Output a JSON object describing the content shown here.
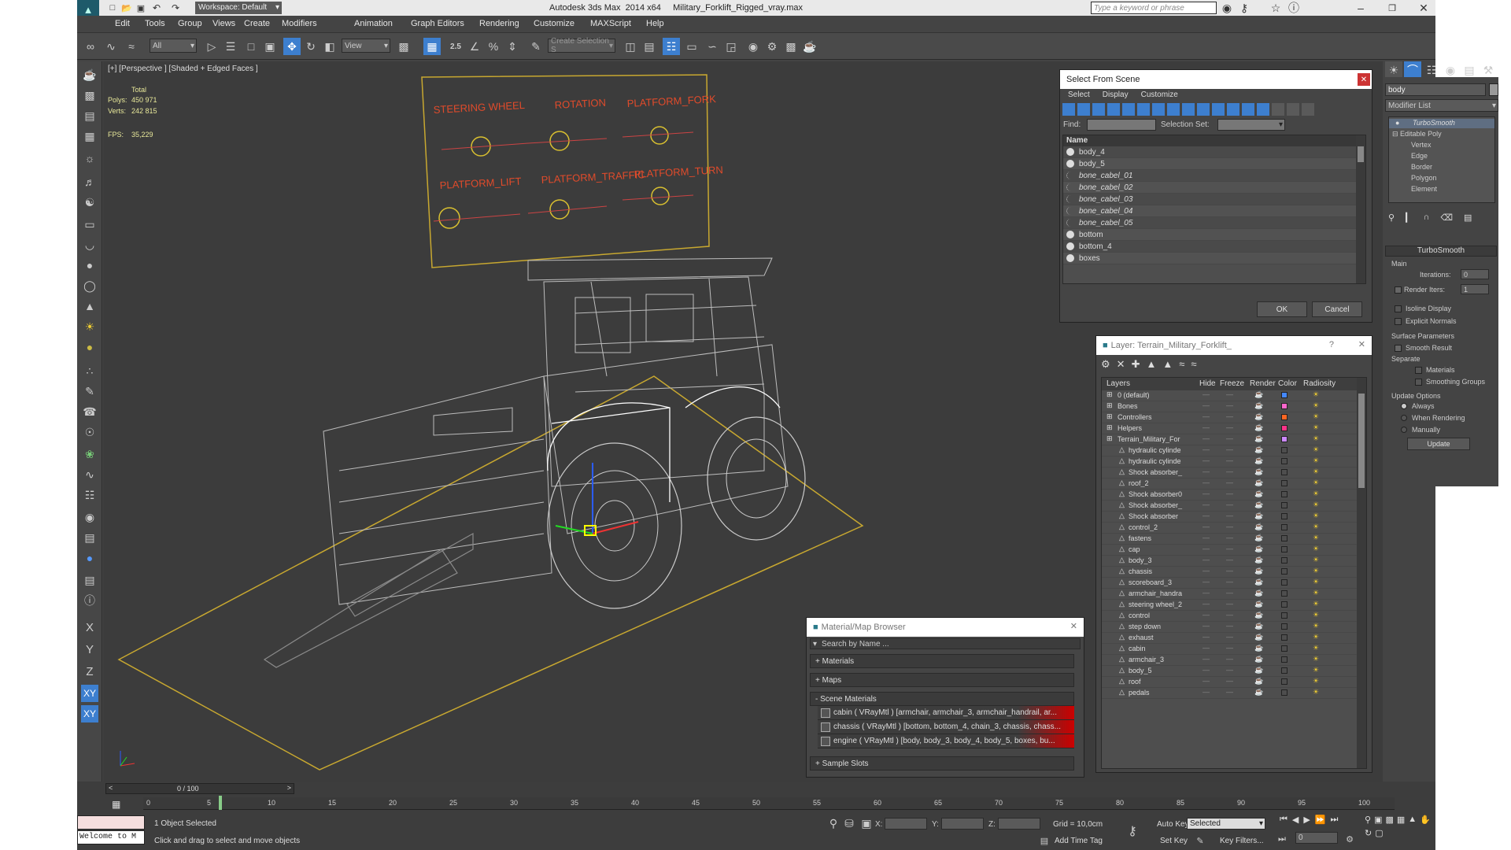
{
  "window": {
    "title": "Autodesk 3ds Max  2014 x64     Military_Forklift_Rigged_vray.max",
    "workspace": "Workspace: Default",
    "search_placeholder": "Type a keyword or phrase"
  },
  "menu": [
    "Edit",
    "Tools",
    "Group",
    "Views",
    "Create",
    "Modifiers",
    "Animation",
    "Graph Editors",
    "Rendering",
    "Customize",
    "MAXScript",
    "Help"
  ],
  "toolbar": {
    "filter": "All",
    "ref_coord": "View",
    "snap_label": "2.5",
    "selection_set": "Create Selection S"
  },
  "viewport": {
    "label": "[+] [Perspective ] [Shaded + Edged Faces ]",
    "stats": {
      "total": "Total",
      "polys_label": "Polys:",
      "polys": "450 971",
      "verts_label": "Verts:",
      "verts": "242 815",
      "fps_label": "FPS:",
      "fps": "35,229"
    },
    "board_labels": [
      "STEERING WHEEL",
      "ROTATION",
      "PLATFORM_FORK",
      "PLATFORM_LIFT",
      "PLATFORM_TRAFFIC",
      "PLATFORM_TURN"
    ]
  },
  "select_from_scene": {
    "title": "Select From Scene",
    "menu": [
      "Select",
      "Display",
      "Customize"
    ],
    "find_label": "Find:",
    "selection_set_label": "Selection Set:",
    "column": "Name",
    "items": [
      "body_4",
      "body_5",
      "bone_cabel_01",
      "bone_cabel_02",
      "bone_cabel_03",
      "bone_cabel_04",
      "bone_cabel_05",
      "bottom",
      "bottom_4",
      "boxes"
    ],
    "ok": "OK",
    "cancel": "Cancel"
  },
  "layer_dialog": {
    "title": "Layer: Terrain_Military_Forklift_",
    "help": "?",
    "columns": [
      "Layers",
      "Hide",
      "Freeze",
      "Render",
      "Color",
      "Radiosity"
    ],
    "layers": [
      {
        "name": "0 (default)",
        "indent": 0,
        "color": "#4488ff"
      },
      {
        "name": "Bones",
        "indent": 0,
        "color": "#ff66cc"
      },
      {
        "name": "Controllers",
        "indent": 0,
        "color": "#ff6622"
      },
      {
        "name": "Helpers",
        "indent": 0,
        "color": "#ff3388"
      },
      {
        "name": "Terrain_Military_For",
        "indent": 0,
        "color": "#cc88ff"
      },
      {
        "name": "hydraulic cylinde",
        "indent": 1
      },
      {
        "name": "hydraulic cylinde",
        "indent": 1
      },
      {
        "name": "Shock absorber_",
        "indent": 1
      },
      {
        "name": "roof_2",
        "indent": 1
      },
      {
        "name": "Shock absorber0",
        "indent": 1
      },
      {
        "name": "Shock absorber_",
        "indent": 1
      },
      {
        "name": "Shock absorber",
        "indent": 1
      },
      {
        "name": "control_2",
        "indent": 1
      },
      {
        "name": "fastens",
        "indent": 1
      },
      {
        "name": "cap",
        "indent": 1
      },
      {
        "name": "body_3",
        "indent": 1
      },
      {
        "name": "chassis",
        "indent": 1
      },
      {
        "name": "scoreboard_3",
        "indent": 1
      },
      {
        "name": "armchair_handra",
        "indent": 1
      },
      {
        "name": "steering wheel_2",
        "indent": 1
      },
      {
        "name": "control",
        "indent": 1
      },
      {
        "name": "step down",
        "indent": 1
      },
      {
        "name": "exhaust",
        "indent": 1
      },
      {
        "name": "cabin",
        "indent": 1
      },
      {
        "name": "armchair_3",
        "indent": 1
      },
      {
        "name": "body_5",
        "indent": 1
      },
      {
        "name": "roof",
        "indent": 1
      },
      {
        "name": "pedals",
        "indent": 1
      }
    ]
  },
  "material_browser": {
    "title": "Material/Map Browser",
    "search": "Search by Name ...",
    "sections": [
      "+ Materials",
      "+ Maps",
      "- Scene Materials"
    ],
    "materials": [
      "cabin  ( VRayMtl )  [armchair, armchair_3, armchair_handrail, ar...",
      "chassis  ( VRayMtl )  [bottom, bottom_4, chain_3, chassis, chass...",
      "engine  ( VRayMtl )  [body, body_3, body_4, body_5, boxes, bu..."
    ],
    "sample_slots": "+ Sample Slots"
  },
  "command_panel": {
    "object_name": "body",
    "modifier_list": "Modifier List",
    "stack": [
      "TurboSmooth",
      "Editable Poly",
      "Vertex",
      "Edge",
      "Border",
      "Polygon",
      "Element"
    ],
    "rollout": "TurboSmooth",
    "main": "Main",
    "iterations_label": "Iterations:",
    "iterations": "0",
    "render_iters_label": "Render Iters:",
    "render_iters": "1",
    "isoline": "Isoline Display",
    "explicit": "Explicit Normals",
    "surface": "Surface Parameters",
    "smooth_result": "Smooth Result",
    "separate": "Separate",
    "materials": "Materials",
    "smoothing": "Smoothing Groups",
    "update_options": "Update Options",
    "always": "Always",
    "when_rendering": "When Rendering",
    "manually": "Manually",
    "update": "Update"
  },
  "timeline": {
    "frame": "0 / 100",
    "ticks": [
      "0",
      "5",
      "10",
      "15",
      "20",
      "25",
      "30",
      "35",
      "40",
      "45",
      "50",
      "55",
      "60",
      "65",
      "70",
      "75",
      "80",
      "85",
      "90",
      "95",
      "100"
    ]
  },
  "status": {
    "maxscript": "Welcome to M",
    "selected": "1 Object Selected",
    "prompt": "Click and drag to select and move objects",
    "x": "X:",
    "y": "Y:",
    "z": "Z:",
    "grid": "Grid = 10,0cm",
    "add_time_tag": "Add Time Tag",
    "auto_key": "Auto Key",
    "set_key": "Set Key",
    "key_mode": "Selected",
    "key_filters": "Key Filters...",
    "frame_field": "0"
  },
  "axis_buttons": [
    "X",
    "Y",
    "Z",
    "XY",
    "XY"
  ]
}
